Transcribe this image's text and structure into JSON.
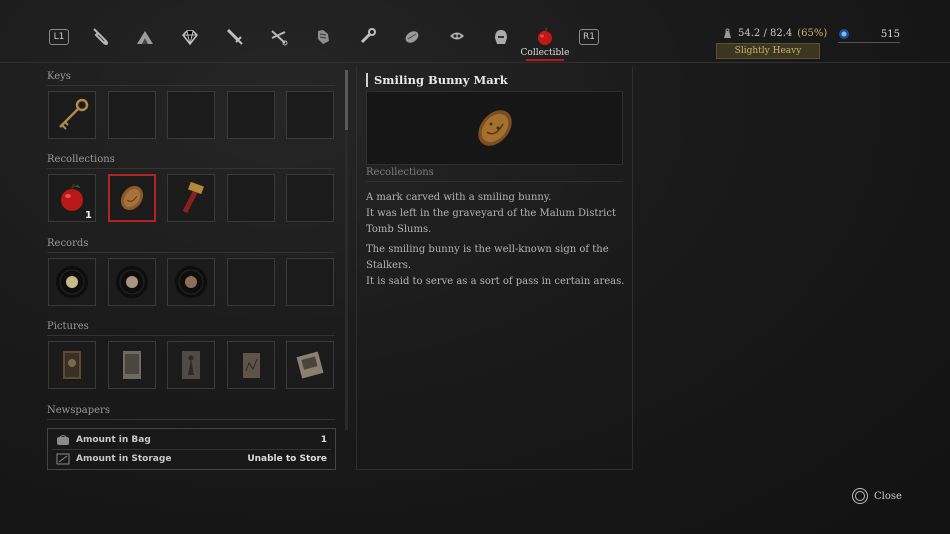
{
  "tabs": {
    "left_shoulder": "L1",
    "right_shoulder": "R1",
    "icons": [
      "tool-icon",
      "camp-icon",
      "gem-icon",
      "dagger-icon",
      "scissors-icon",
      "gauntlet-icon",
      "wrench-icon",
      "bandage-icon",
      "mask-icon",
      "helmet-icon",
      "apple-icon"
    ],
    "active_label": "Collectible",
    "accent_color": "#b41c1c"
  },
  "status": {
    "weight_text": "54.2 / 82.4",
    "weight_percent": "(65%)",
    "load_state": "Slightly Heavy",
    "currency_value": "515"
  },
  "sections": {
    "keys": "Keys",
    "recollections": "Recollections",
    "records": "Records",
    "pictures": "Pictures",
    "newspapers": "Newspapers"
  },
  "slots": {
    "recollection_apple_qty": "1"
  },
  "info": {
    "bag_label": "Amount in Bag",
    "bag_value": "1",
    "storage_label": "Amount in Storage",
    "storage_value": "Unable to Store"
  },
  "detail": {
    "title": "Smiling Bunny Mark",
    "category": "Recollections",
    "line1": "A mark carved with a smiling bunny.",
    "line2": "It was left in the graveyard of the Malum District Tomb Slums.",
    "line3": "The smiling bunny is the well-known sign of the Stalkers.",
    "line4": "It is said to serve as a sort of pass in certain areas."
  },
  "footer": {
    "close_label": "Close"
  }
}
